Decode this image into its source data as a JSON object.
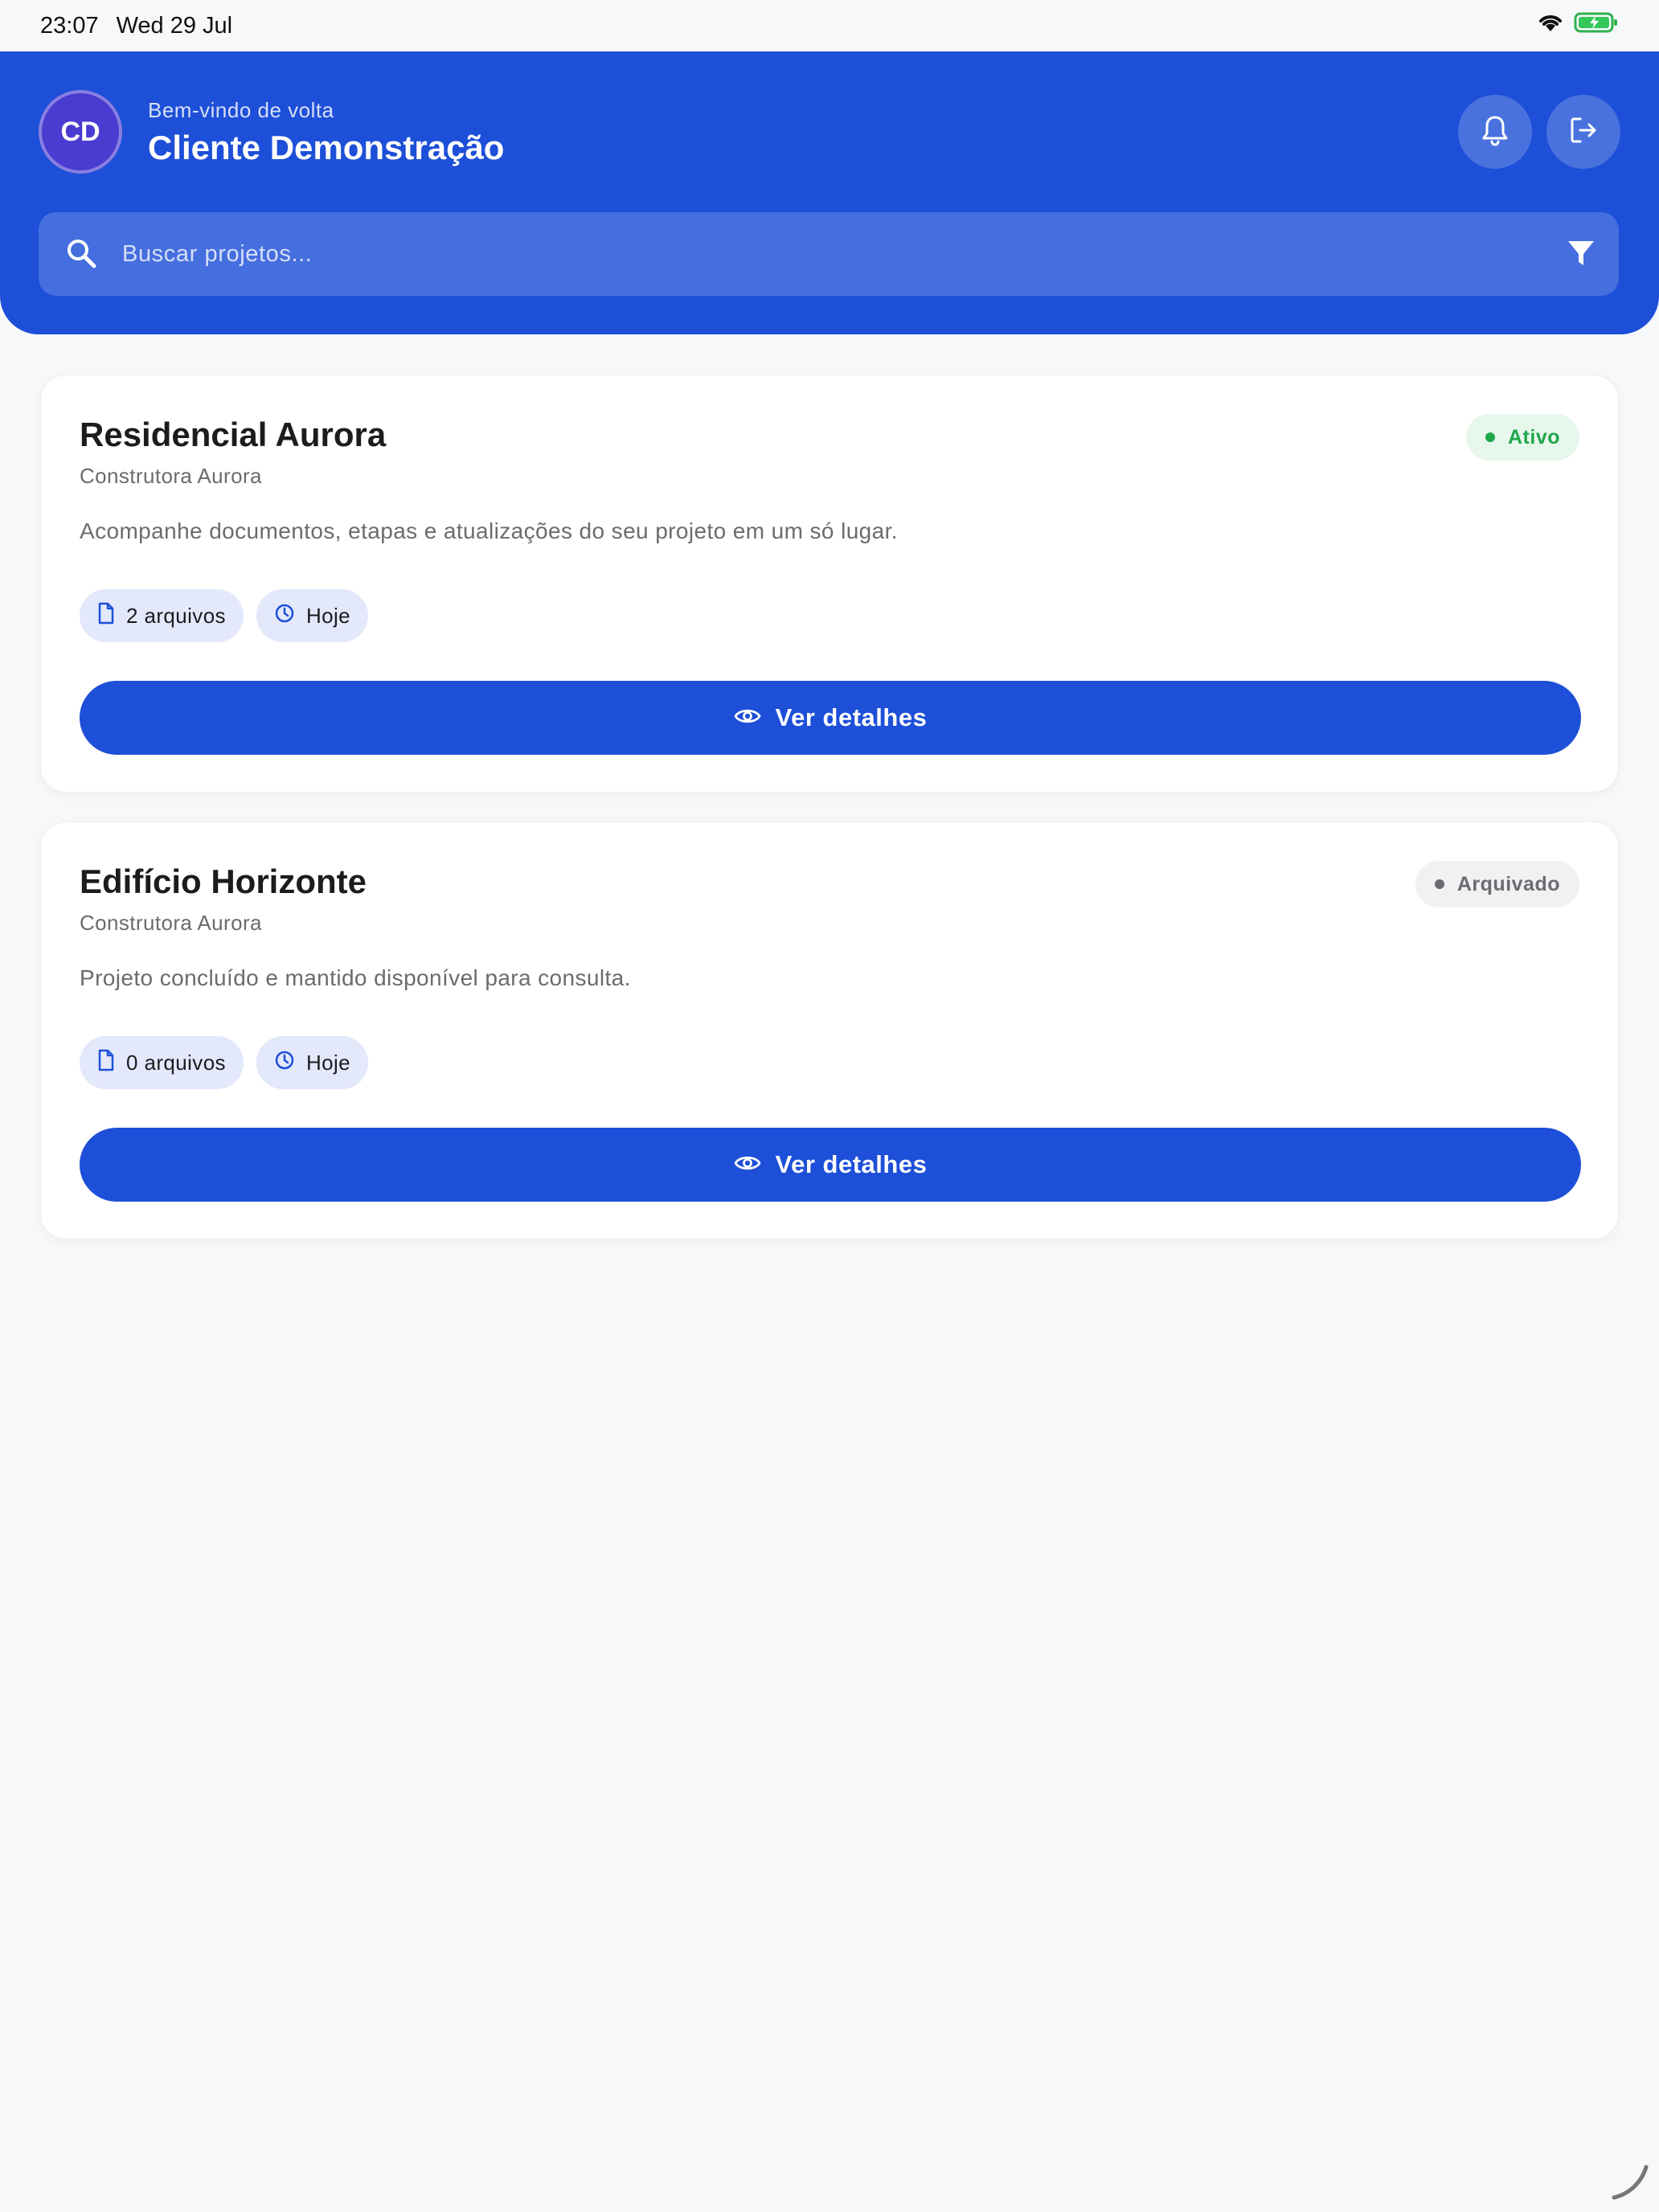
{
  "status_bar": {
    "time": "23:07",
    "date": "Wed 29 Jul"
  },
  "header": {
    "avatar_initials": "CD",
    "welcome": "Bem-vindo de volta",
    "username": "Cliente Demonstração",
    "bell_icon": "bell-icon",
    "logout_icon": "logout-icon",
    "accent_color": "#1d4fd8"
  },
  "search": {
    "placeholder": "Buscar projetos...",
    "value": "",
    "filter_icon": "filter-icon"
  },
  "projects": [
    {
      "title": "Residencial Aurora",
      "company": "Construtora Aurora",
      "description": "Acompanhe documentos, etapas e atualizações do seu projeto em um só lugar.",
      "status": "Ativo",
      "status_color": "#1fa64a",
      "files": "2 arquivos",
      "updated": "Hoje",
      "button": "Ver detalhes"
    },
    {
      "title": "Edifício Horizonte",
      "company": "Construtora Aurora",
      "description": "Projeto concluído e mantido disponível para consulta.",
      "status": "Arquivado",
      "status_color": "#6b6b70",
      "files": "0 arquivos",
      "updated": "Hoje",
      "button": "Ver detalhes"
    }
  ]
}
